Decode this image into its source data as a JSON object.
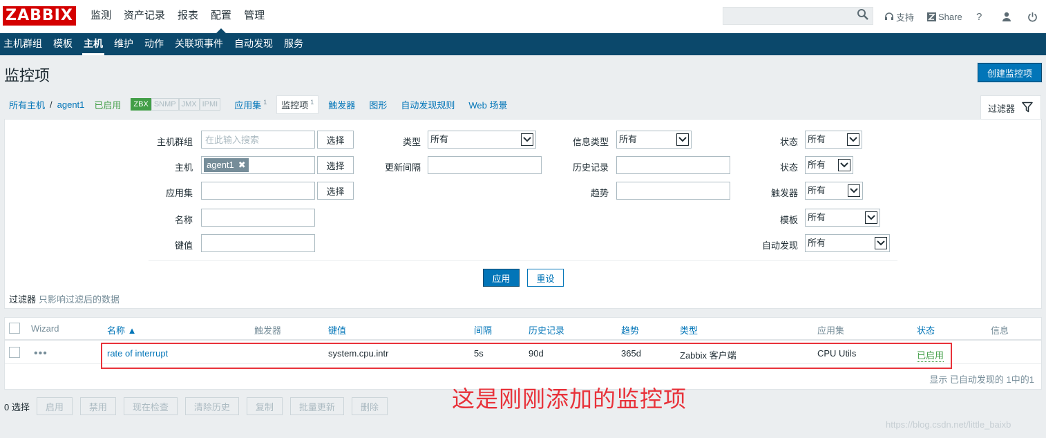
{
  "header": {
    "logo": "ZABBIX",
    "menu": [
      "监测",
      "资产记录",
      "报表",
      "配置",
      "管理"
    ],
    "active_menu": 3,
    "search_placeholder": "",
    "support_label": "支持",
    "share_label": "Share",
    "help_label": "?"
  },
  "submenu": {
    "items": [
      "主机群组",
      "模板",
      "主机",
      "维护",
      "动作",
      "关联项事件",
      "自动发现",
      "服务"
    ],
    "active": 2
  },
  "page": {
    "title": "监控项",
    "create_button": "创建监控项"
  },
  "breadcrumb": {
    "all_hosts": "所有主机",
    "separator": "/",
    "host": "agent1",
    "status": "已启用",
    "availability": [
      {
        "label": "ZBX",
        "active": true
      },
      {
        "label": "SNMP",
        "active": false
      },
      {
        "label": "JMX",
        "active": false
      },
      {
        "label": "IPMI",
        "active": false
      }
    ],
    "tabs": [
      {
        "label": "应用集",
        "count": "1"
      },
      {
        "label": "监控项",
        "count": "1"
      },
      {
        "label": "触发器",
        "count": ""
      },
      {
        "label": "图形",
        "count": ""
      },
      {
        "label": "自动发现规则",
        "count": ""
      },
      {
        "label": "Web 场景",
        "count": ""
      }
    ]
  },
  "filter": {
    "tab_label": "过滤器",
    "host_group_label": "主机群组",
    "host_group_placeholder": "在此输入搜索",
    "select_label": "选择",
    "host_label": "主机",
    "host_chip": "agent1",
    "application_label": "应用集",
    "name_label": "名称",
    "key_label": "键值",
    "type_label": "类型",
    "type_value": "所有",
    "update_interval_label": "更新间隔",
    "info_type_label": "信息类型",
    "info_type_value": "所有",
    "history_label": "历史记录",
    "trends_label": "趋势",
    "state_label": "状态",
    "state_value": "所有",
    "status_label": "状态",
    "status_value": "所有",
    "triggers_label": "触发器",
    "triggers_value": "所有",
    "template_label": "模板",
    "template_value": "所有",
    "discovery_label": "自动发现",
    "discovery_value": "所有",
    "apply_button": "应用",
    "reset_button": "重设",
    "note_bold": "过滤器",
    "note_text": "只影响过滤后的数据"
  },
  "table": {
    "columns": {
      "wizard": "Wizard",
      "name": "名称 ▲",
      "triggers": "触发器",
      "key": "键值",
      "interval": "间隔",
      "history": "历史记录",
      "trends": "趋势",
      "type": "类型",
      "applications": "应用集",
      "status": "状态",
      "info": "信息"
    },
    "rows": [
      {
        "name": "rate of interrupt",
        "triggers": "",
        "key": "system.cpu.intr",
        "interval": "5s",
        "history": "90d",
        "trends": "365d",
        "type": "Zabbix 客户端",
        "applications": "CPU Utils",
        "status": "已启用",
        "info": ""
      }
    ],
    "footer": "显示 已自动发现的 1中的1"
  },
  "annotation": {
    "text": "这是刚刚添加的监控项"
  },
  "actions": {
    "selected": "0 选择",
    "buttons": [
      "启用",
      "禁用",
      "现在检查",
      "清除历史",
      "复制",
      "批量更新",
      "删除"
    ]
  },
  "watermark": "https://blog.csdn.net/little_baixb"
}
